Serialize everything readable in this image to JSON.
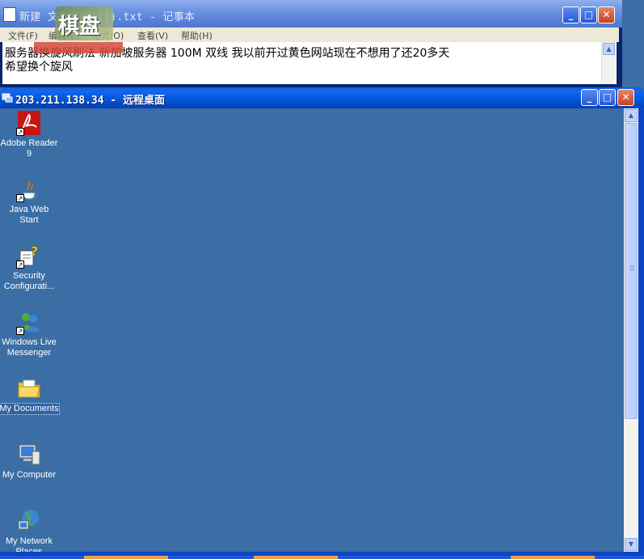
{
  "notepad": {
    "title": "新建 文本文档 (1).txt - 记事本",
    "menu": [
      "文件(F)",
      "编辑(E)",
      "格式(O)",
      "查看(V)",
      "帮助(H)"
    ],
    "content_lines": [
      "服务器换旋风刷法  新加坡服务器 100M 双线  我以前开过黄色网站现在不想用了还20多天",
      "希望换个旋风"
    ],
    "controls": {
      "minimize": "_",
      "maximize": "□",
      "close": "✕"
    }
  },
  "watermark": {
    "text": "棋盘"
  },
  "remote_desktop": {
    "title": "203.211.138.34 - 远程桌面",
    "controls": {
      "minimize": "_",
      "maximize": "□",
      "close": "✕"
    },
    "desktop_icons": [
      {
        "label": "Adobe Reader 9",
        "icon": "adobe-reader-icon"
      },
      {
        "label": "Java Web Start",
        "icon": "java-icon"
      },
      {
        "label": "Security Configurati...",
        "icon": "security-config-icon"
      },
      {
        "label": "Windows Live Messenger",
        "icon": "messenger-icon"
      },
      {
        "label": "My Documents",
        "icon": "folder-icon"
      },
      {
        "label": "My Computer",
        "icon": "computer-icon"
      },
      {
        "label": "My Network Places",
        "icon": "network-icon"
      }
    ],
    "scroll_arrows": {
      "up": "▲",
      "down": "▼"
    }
  },
  "colors": {
    "desktop": "#3a6ea5",
    "titlebar": "#0a5fe0",
    "scroll_thumb": "#c1d3fb"
  }
}
